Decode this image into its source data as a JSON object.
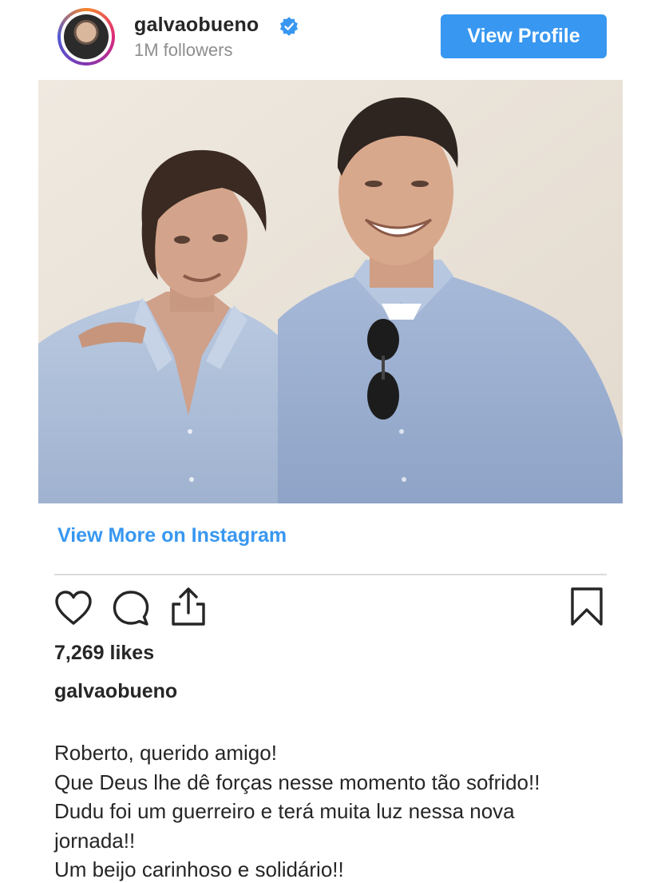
{
  "header": {
    "username": "galvaobueno",
    "followers": "1M followers",
    "view_profile_label": "View Profile"
  },
  "post": {
    "view_more_label": "View More on Instagram",
    "likes": "7,269 likes",
    "caption_user": "galvaobueno",
    "caption_lines": [
      "Roberto, querido amigo!",
      "Que Deus lhe dê forças nesse momento tão sofrido!!",
      "Dudu foi um guerreiro e terá muita luz nessa nova",
      "jornada!!",
      "Um beijo carinhoso e solidário!!"
    ]
  },
  "icons": {
    "verified": "verified-badge-icon",
    "like": "heart-icon",
    "comment": "comment-bubble-icon",
    "share": "share-icon",
    "save": "bookmark-icon"
  },
  "colors": {
    "accent": "#3897f0",
    "text": "#262626",
    "muted": "#8e8e8e",
    "divider": "#dbdbdb"
  }
}
